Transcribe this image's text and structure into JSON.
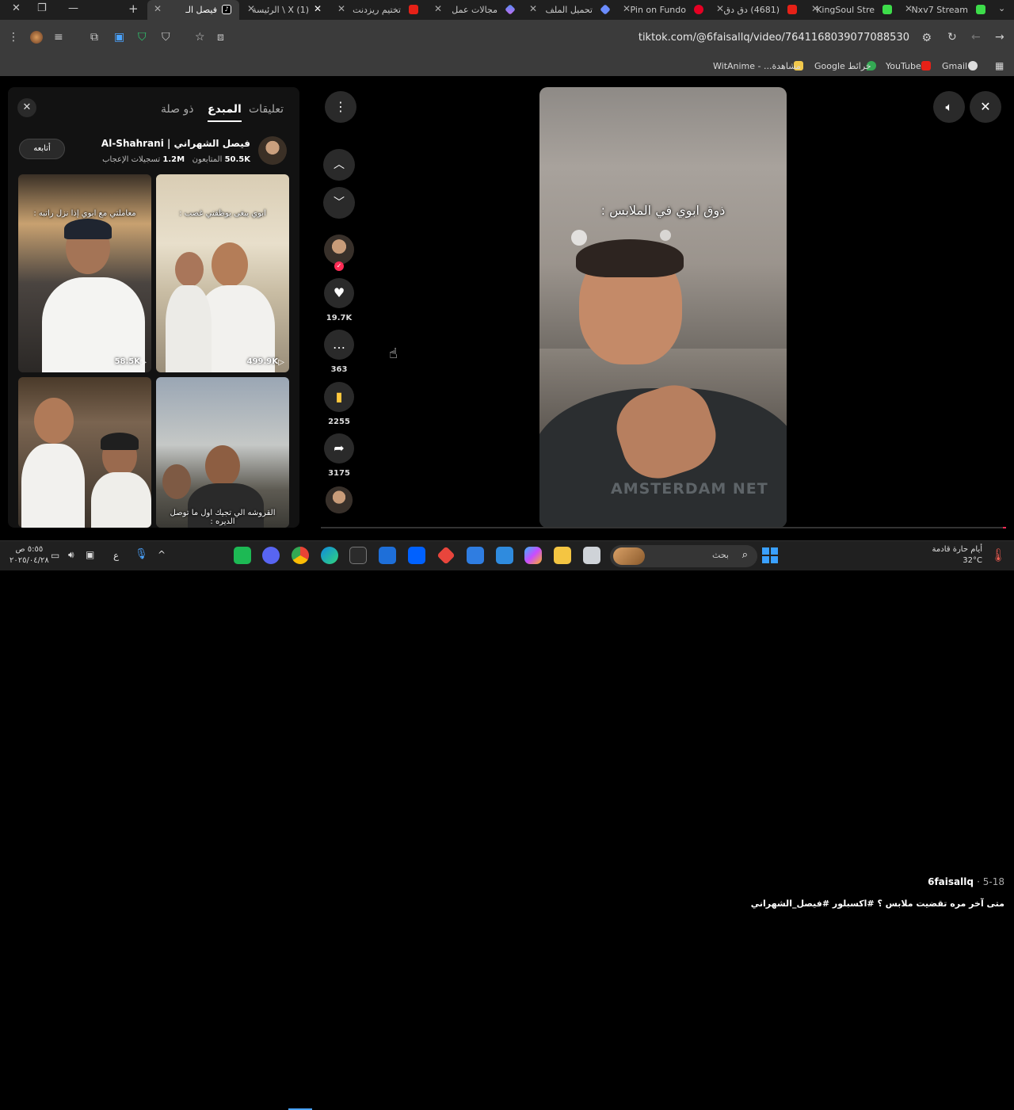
{
  "browser": {
    "tabs": [
      {
        "title": "Nxv7 Stream",
        "color": "#3ddc4a"
      },
      {
        "title": "KingSoul Stre",
        "color": "#3ddc4a"
      },
      {
        "title": "(4681) دق دق",
        "color": "#e62117"
      },
      {
        "title": "Pin on Fundo",
        "color": "#e60023"
      },
      {
        "title": "تحميل الملف",
        "color": "#6b8cff"
      },
      {
        "title": "مجالات عمل",
        "color": "#4f8df5"
      },
      {
        "title": "تختيم ريزدنت",
        "color": "#e62117"
      },
      {
        "title": "(1) X \\ الرئيسة",
        "color": "#ffffff"
      },
      {
        "title": "فيصل الـ",
        "color": "#000000",
        "active": true
      }
    ],
    "new_tab": "+",
    "url": "tiktok.com/@6faisallq/video/7641168039077088530",
    "bookmarks": [
      {
        "label": "Gmail",
        "color": "#ea4335"
      },
      {
        "label": "YouTube",
        "color": "#e62117"
      },
      {
        "label": "خرائط Google",
        "color": "#34a853"
      },
      {
        "label": "مشاهدة... - WitAnime",
        "color": "#f2c94c"
      }
    ]
  },
  "panel": {
    "tabs": [
      "تعليقات",
      "المبدع",
      "ذو صلة"
    ],
    "active_tab": "المبدع",
    "close": "✕",
    "creator": {
      "name": "فيصل الشهراني | Al-Shahrani",
      "followers": "50.5K",
      "followers_label": "المتابعون",
      "likes": "1.2M",
      "likes_label": "تسجيلات الإعجاب",
      "follow_button": "أتابعه"
    },
    "videos": [
      {
        "caption": "ابوي يبغى يوظفني غصب :",
        "views": "499.9K"
      },
      {
        "caption": "معاملتي مع ابوي إذا نزل راتبه :",
        "views": "58.5K"
      },
      {
        "caption": "القروشه الي تجيك اول ما توصل الديره :",
        "views": ""
      },
      {
        "caption": "",
        "views": ""
      }
    ]
  },
  "actions": {
    "like_count": "19.7K",
    "comment_count": "363",
    "save_count": "2255",
    "share_count": "3175"
  },
  "video": {
    "caption": "ذوق ابوي في الملابس :",
    "author": "6faisallq",
    "date": "5-18",
    "description": "متى آخر مره تقضيت ملابس ؟ #اكسبلور #فيصل_الشهراني",
    "shirt_text": "AMSTERDAM NETHERLANDS"
  },
  "taskbar": {
    "search_placeholder": "بحث",
    "weather_desc": "أيام حارة قادمة",
    "temperature": "32°C",
    "time": "٥:٥٥ ص",
    "date": "٢٠٢٥/٠٤/٢٨",
    "language": "ع"
  }
}
